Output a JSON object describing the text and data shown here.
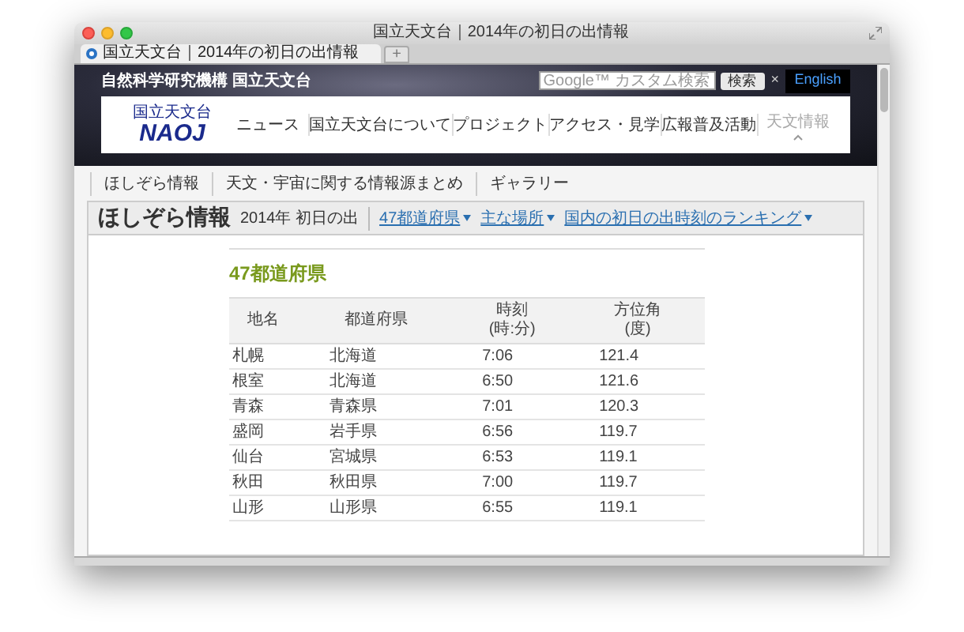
{
  "window": {
    "title": "国立天文台｜2014年の初日の出情報"
  },
  "tab": {
    "title": "国立天文台｜2014年の初日の出情報",
    "new_tab": "+"
  },
  "header": {
    "org_name": "自然科学研究機構 国立天文台",
    "search": {
      "placeholder": "Google™ カスタム検索"
    },
    "search_button": "検索",
    "clear": "×",
    "english": "English",
    "logo_small": "国立天文台",
    "logo": "NAOJ"
  },
  "nav": [
    {
      "label": "ニュース",
      "selected": false
    },
    {
      "label": "国立天文台について",
      "selected": false
    },
    {
      "label": "プロジェクト",
      "selected": false
    },
    {
      "label": "アクセス・見学",
      "selected": false
    },
    {
      "label": "広報普及活動",
      "selected": false
    },
    {
      "label": "天文情報",
      "selected": true
    }
  ],
  "subnav": [
    "ほしぞら情報",
    "天文・宇宙に関する情報源まとめ",
    "ギャラリー"
  ],
  "panel": {
    "title": "ほしぞら情報",
    "subtitle": "2014年 初日の出",
    "links": [
      "47都道府県",
      "主な場所",
      "国内の初日の出時刻のランキング"
    ]
  },
  "section": {
    "heading": "47都道府県"
  },
  "table": {
    "columns": [
      "地名",
      "都道府県",
      "時刻\n(時:分)",
      "方位角\n(度)"
    ],
    "rows": [
      [
        "札幌",
        "北海道",
        "7:06",
        "121.4"
      ],
      [
        "根室",
        "北海道",
        "6:50",
        "121.6"
      ],
      [
        "青森",
        "青森県",
        "7:01",
        "120.3"
      ],
      [
        "盛岡",
        "岩手県",
        "6:56",
        "119.7"
      ],
      [
        "仙台",
        "宮城県",
        "6:53",
        "119.1"
      ],
      [
        "秋田",
        "秋田県",
        "7:00",
        "119.7"
      ],
      [
        "山形",
        "山形県",
        "6:55",
        "119.1"
      ]
    ]
  }
}
